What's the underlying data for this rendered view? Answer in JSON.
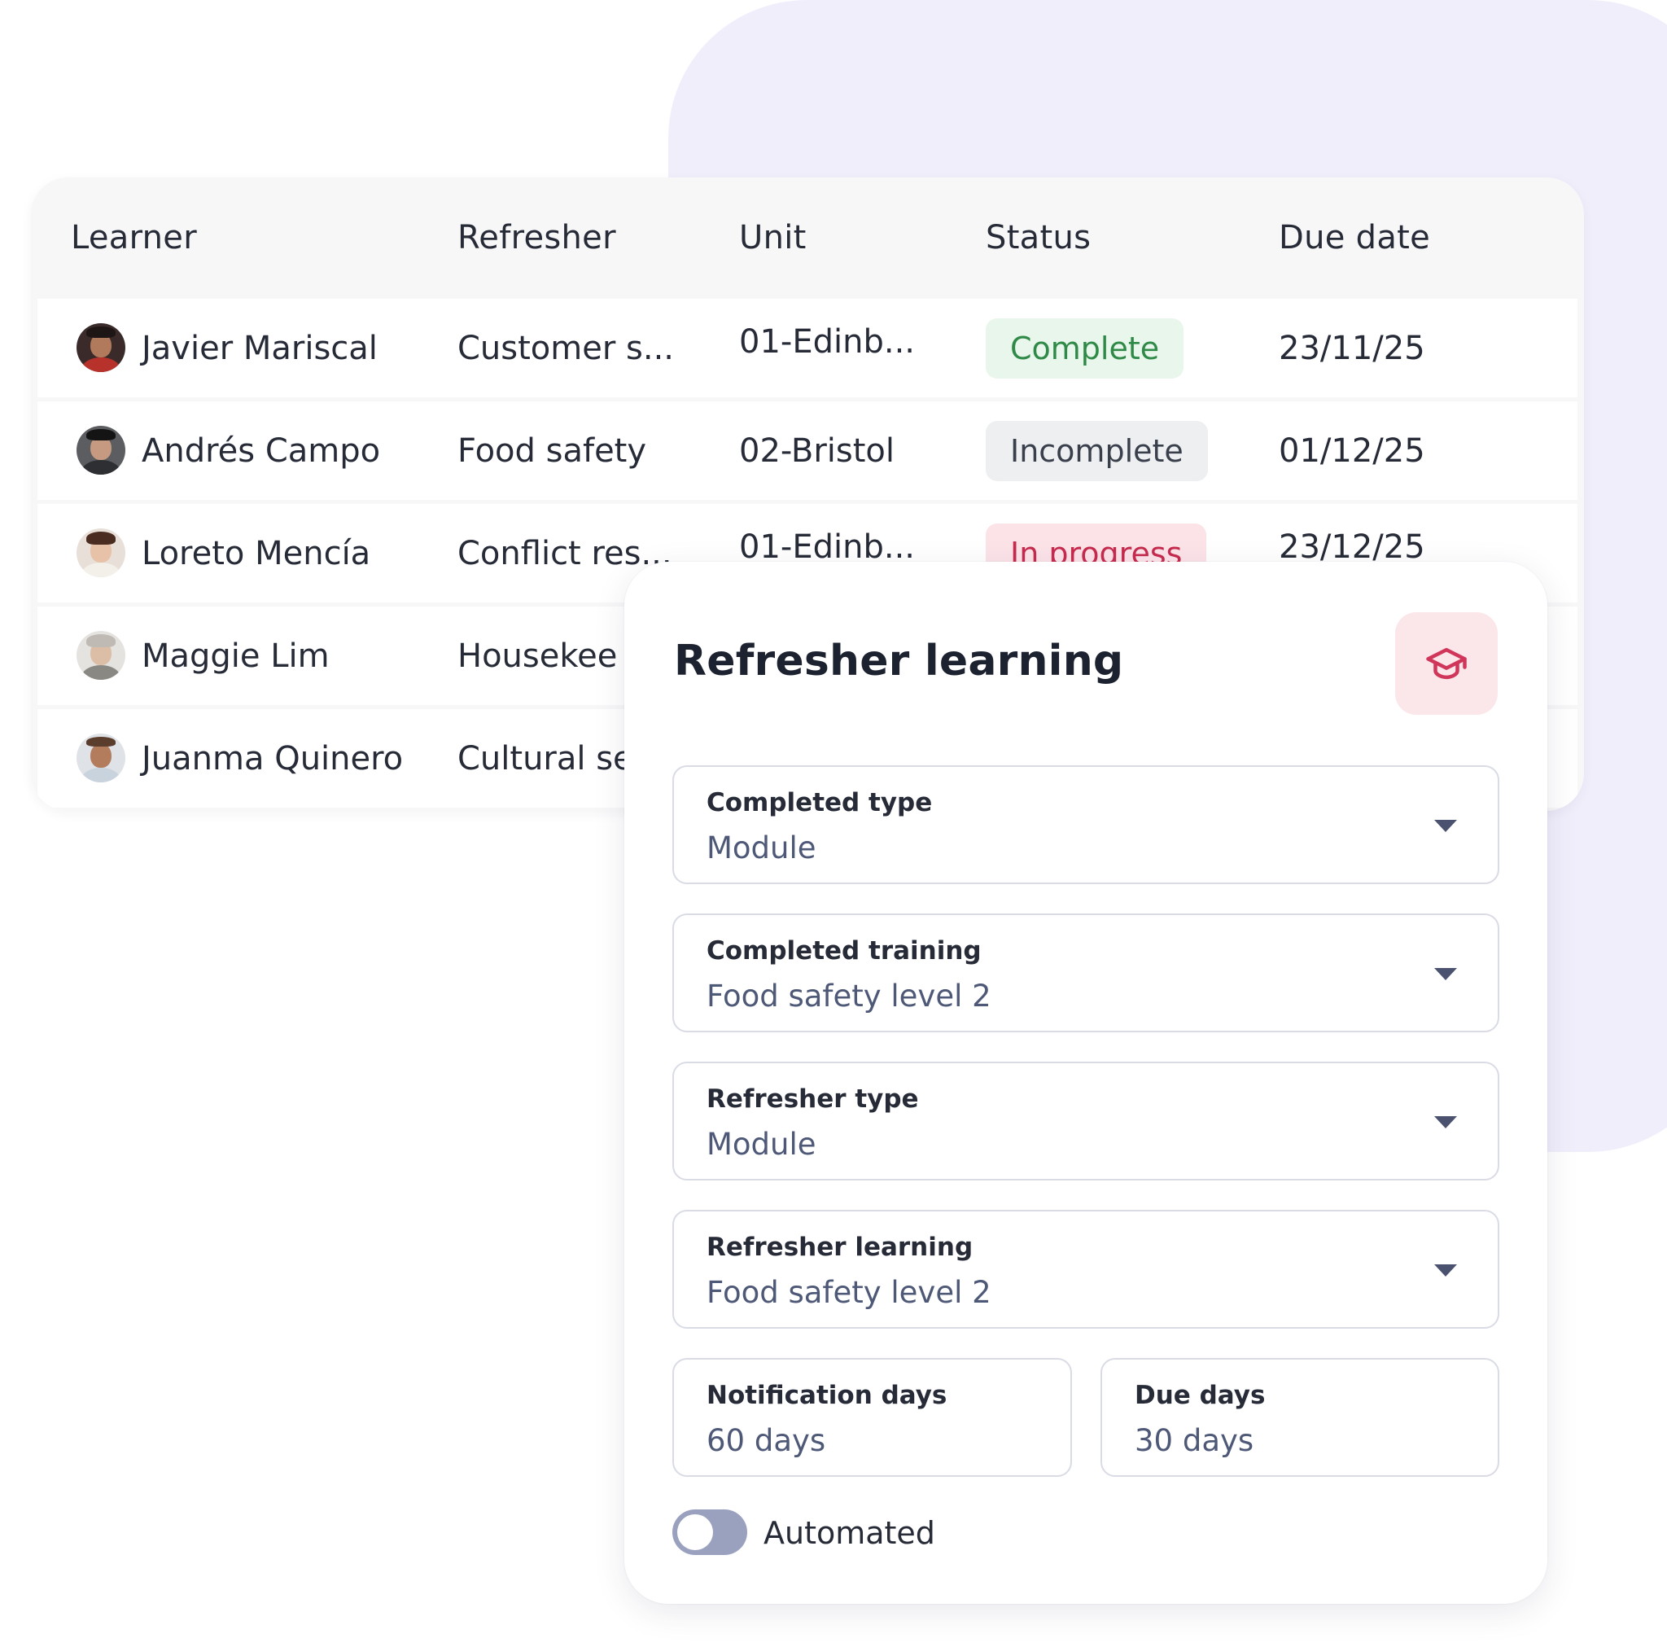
{
  "table": {
    "headers": {
      "learner": "Learner",
      "refresher": "Refresher",
      "unit": "Unit",
      "status": "Status",
      "due_date": "Due date"
    },
    "rows": [
      {
        "learner": "Javier Mariscal",
        "refresher": "Customer s...",
        "unit": "01-Edinb...",
        "status": "Complete",
        "due_date": "23/11/25"
      },
      {
        "learner": "Andrés Campo",
        "refresher": "Food safety",
        "unit": "02-Bristol",
        "status": "Incomplete",
        "due_date": "01/12/25"
      },
      {
        "learner": "Loreto Mencía",
        "refresher": "Conflict res...",
        "unit": "01-Edinb...",
        "status": "In progress",
        "due_date": "23/12/25"
      },
      {
        "learner": "Maggie Lim",
        "refresher": "Housekee",
        "unit": "",
        "status": "",
        "due_date": ""
      },
      {
        "learner": "Juanma Quinero",
        "refresher": "Cultural se",
        "unit": "",
        "status": "",
        "due_date": ""
      }
    ]
  },
  "panel": {
    "title": "Refresher learning",
    "icon": "graduation-cap-icon",
    "fields": {
      "completed_type": {
        "label": "Completed type",
        "value": "Module"
      },
      "completed_training": {
        "label": "Completed training",
        "value": "Food safety level 2"
      },
      "refresher_type": {
        "label": "Refresher type",
        "value": "Module"
      },
      "refresher_learning": {
        "label": "Refresher learning",
        "value": "Food safety level 2"
      },
      "notification_days": {
        "label": "Notification days",
        "value": "60 days"
      },
      "due_days": {
        "label": "Due days",
        "value": "30 days"
      }
    },
    "toggle": {
      "label": "Automated",
      "on": false
    }
  },
  "colors": {
    "background_blob": "#f1eefc",
    "complete_bg": "#e8f6ec",
    "complete_text": "#2f8a47",
    "incomplete_bg": "#eeeff1",
    "incomplete_text": "#3a3f4c",
    "in_progress_bg": "#fbe3e8",
    "in_progress_text": "#c72b4e",
    "accent_pink": "#d0355a"
  }
}
